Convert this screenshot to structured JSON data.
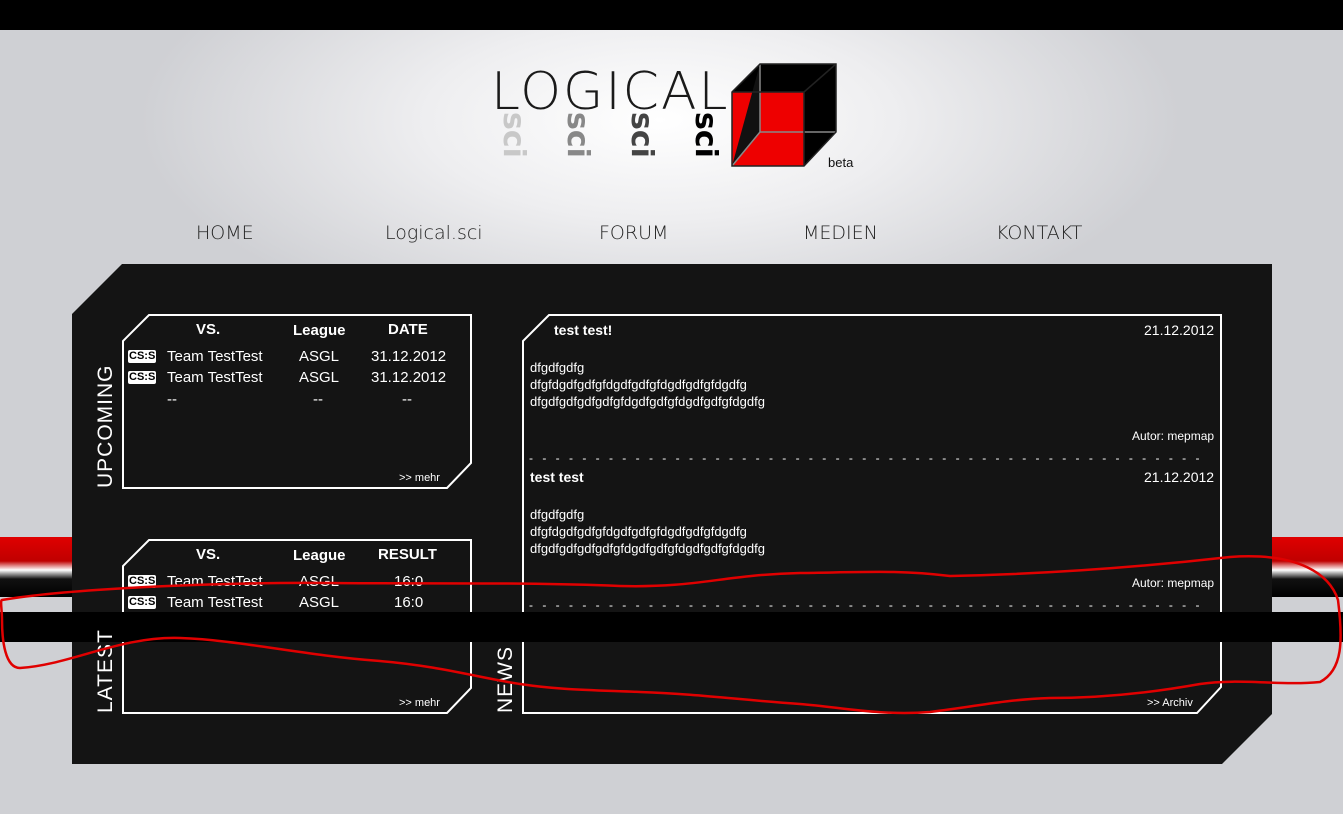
{
  "logo": {
    "main_text": "LOGICAL",
    "sci_text": "sci",
    "sci_colors": [
      "#c8c8c8",
      "#888888",
      "#444444",
      "#000000"
    ],
    "beta_label": "beta",
    "cube_colors": {
      "face": "#000000",
      "accent": "#ee0000"
    }
  },
  "nav": {
    "items": [
      {
        "label": "HOME"
      },
      {
        "label": "Logical.sci"
      },
      {
        "label": "FORUM"
      },
      {
        "label": "MEDIEN"
      },
      {
        "label": "KONTAKT"
      }
    ]
  },
  "upcoming": {
    "section_label": "UPCOMING",
    "headers": {
      "vs": "VS.",
      "league": "League",
      "date": "DATE"
    },
    "rows": [
      {
        "game": "CS:S",
        "team": "Team TestTest",
        "league": "ASGL",
        "date": "31.12.2012"
      },
      {
        "game": "CS:S",
        "team": "Team TestTest",
        "league": "ASGL",
        "date": "31.12.2012"
      },
      {
        "game": "",
        "team": "--",
        "league": "--",
        "date": "--"
      }
    ],
    "more_label": ">> mehr"
  },
  "latest": {
    "section_label": "LATEST",
    "headers": {
      "vs": "VS.",
      "league": "League",
      "result": "RESULT"
    },
    "rows": [
      {
        "game": "CS:S",
        "team": "Team TestTest",
        "league": "ASGL",
        "result": "16:0"
      },
      {
        "game": "CS:S",
        "team": "Team TestTest",
        "league": "ASGL",
        "result": "16:0"
      }
    ],
    "more_label": ">> mehr"
  },
  "news": {
    "section_label": "NEWS",
    "items": [
      {
        "title": "test test!",
        "date": "21.12.2012",
        "body": "dfgdfgdfg\ndfgfdgdfgdfgfdgdfgdfgfdgdfgdfgfdgdfg\ndfgdfgdfgdfgdfgfdgdfgdfgfdgdfgdfgfdgdfg",
        "author": "Autor: mepmap"
      },
      {
        "title": "test test",
        "date": "21.12.2012",
        "body": "dfgdfgdfg\ndfgfdgdfgdfgfdgdfgdfgfdgdfgdfgfdgdfg\ndfgdfgdfgdfgdfgfdgdfgdfgfdgdfgdfgfdgdfg",
        "author": "Autor: mepmap"
      }
    ],
    "separator": "- - - - - - - - - - - - - - - - - - - - - - - - - - - - - - - - - - - - - - - - - - - - - - - - - - - - - - - - - - - - - - - - - - - - - - - - - - - - - - - - - - - - -",
    "archive_label": ">> Archiv"
  },
  "annotation_color": "#e00000"
}
